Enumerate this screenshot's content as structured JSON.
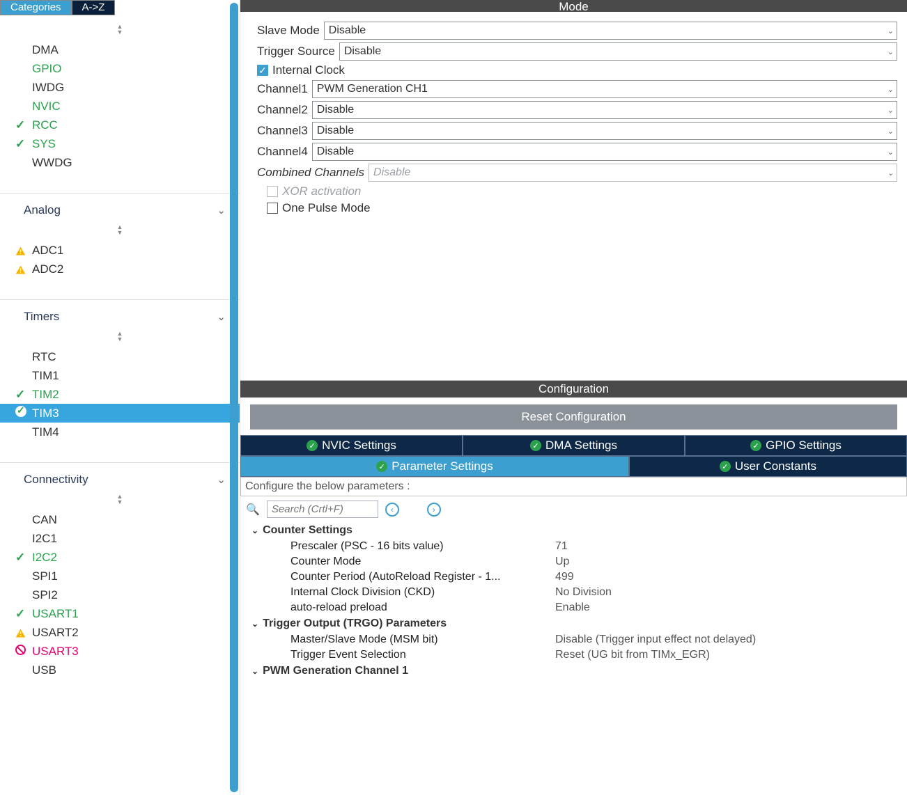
{
  "tabs": {
    "categories": "Categories",
    "az": "A->Z"
  },
  "sidebar": {
    "system_core": {
      "items": [
        {
          "label": "DMA",
          "status": "none"
        },
        {
          "label": "GPIO",
          "status": "green"
        },
        {
          "label": "IWDG",
          "status": "none"
        },
        {
          "label": "NVIC",
          "status": "green"
        },
        {
          "label": "RCC",
          "status": "green-check"
        },
        {
          "label": "SYS",
          "status": "green-check"
        },
        {
          "label": "WWDG",
          "status": "none"
        }
      ]
    },
    "analog": {
      "title": "Analog",
      "items": [
        {
          "label": "ADC1",
          "status": "warn"
        },
        {
          "label": "ADC2",
          "status": "warn"
        }
      ]
    },
    "timers": {
      "title": "Timers",
      "items": [
        {
          "label": "RTC",
          "status": "none"
        },
        {
          "label": "TIM1",
          "status": "none"
        },
        {
          "label": "TIM2",
          "status": "green-check"
        },
        {
          "label": "TIM3",
          "status": "sel-check"
        },
        {
          "label": "TIM4",
          "status": "none"
        }
      ]
    },
    "connectivity": {
      "title": "Connectivity",
      "items": [
        {
          "label": "CAN",
          "status": "none"
        },
        {
          "label": "I2C1",
          "status": "none"
        },
        {
          "label": "I2C2",
          "status": "green-check"
        },
        {
          "label": "SPI1",
          "status": "none"
        },
        {
          "label": "SPI2",
          "status": "none"
        },
        {
          "label": "USART1",
          "status": "green-check"
        },
        {
          "label": "USART2",
          "status": "warn"
        },
        {
          "label": "USART3",
          "status": "ban"
        },
        {
          "label": "USB",
          "status": "none"
        }
      ]
    }
  },
  "mode": {
    "title": "Mode",
    "slave_mode": {
      "label": "Slave Mode",
      "value": "Disable"
    },
    "trigger_source": {
      "label": "Trigger Source",
      "value": "Disable"
    },
    "internal_clock": {
      "label": "Internal Clock",
      "checked": true
    },
    "channel1": {
      "label": "Channel1",
      "value": "PWM Generation CH1"
    },
    "channel2": {
      "label": "Channel2",
      "value": "Disable"
    },
    "channel3": {
      "label": "Channel3",
      "value": "Disable"
    },
    "channel4": {
      "label": "Channel4",
      "value": "Disable"
    },
    "combined": {
      "label": "Combined Channels",
      "value": "Disable"
    },
    "xor": {
      "label": "XOR activation",
      "checked": false
    },
    "one_pulse": {
      "label": "One Pulse Mode",
      "checked": false
    }
  },
  "config": {
    "title": "Configuration",
    "reset": "Reset Configuration",
    "tabs": {
      "nvic": "NVIC Settings",
      "dma": "DMA Settings",
      "gpio": "GPIO Settings",
      "param": "Parameter Settings",
      "user": "User Constants"
    },
    "hint": "Configure the below parameters :",
    "search_placeholder": "Search (Crtl+F)",
    "groups": [
      {
        "name": "Counter Settings",
        "rows": [
          {
            "k": "Prescaler (PSC - 16 bits value)",
            "v": "71"
          },
          {
            "k": "Counter Mode",
            "v": "Up"
          },
          {
            "k": "Counter Period (AutoReload Register - 1...",
            "v": "499"
          },
          {
            "k": "Internal Clock Division (CKD)",
            "v": "No Division"
          },
          {
            "k": "auto-reload preload",
            "v": "Enable"
          }
        ]
      },
      {
        "name": "Trigger Output (TRGO) Parameters",
        "rows": [
          {
            "k": "Master/Slave Mode (MSM bit)",
            "v": "Disable (Trigger input effect not delayed)"
          },
          {
            "k": "Trigger Event Selection",
            "v": "Reset (UG bit from TIMx_EGR)"
          }
        ]
      },
      {
        "name": "PWM Generation Channel 1",
        "rows": []
      }
    ]
  }
}
